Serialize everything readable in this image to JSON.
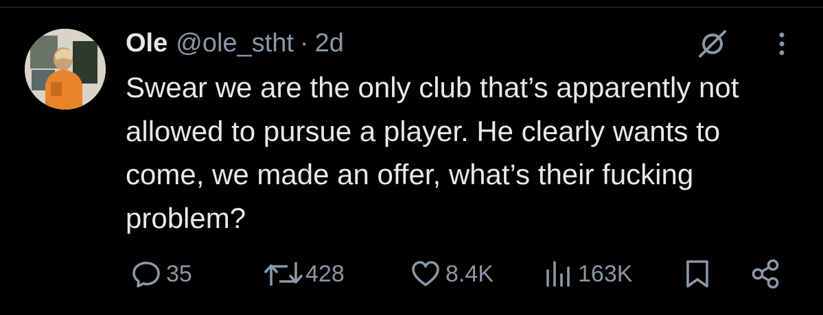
{
  "tweet": {
    "author_name": "Ole",
    "author_handle": "@ole_stht",
    "separator": "·",
    "timestamp": "2d",
    "text": "Swear we are the only club that’s apparently not allowed to pursue a player. He clearly wants to come, we made an offer, what’s their fucking problem?",
    "avatar_icon": "profile-photo"
  },
  "actions": {
    "replies": "35",
    "reposts": "428",
    "likes": "8.4K",
    "views": "163K",
    "reply_icon": "speech-bubble-icon",
    "repost_icon": "repost-arrows-icon",
    "like_icon": "heart-icon",
    "views_icon": "bar-chart-icon",
    "bookmark_icon": "bookmark-icon",
    "share_icon": "share-icon"
  },
  "colors": {
    "background": "#000000",
    "primary_text": "#e7e9ea",
    "secondary_text": "#8b98a5",
    "border": "#2f3336"
  }
}
